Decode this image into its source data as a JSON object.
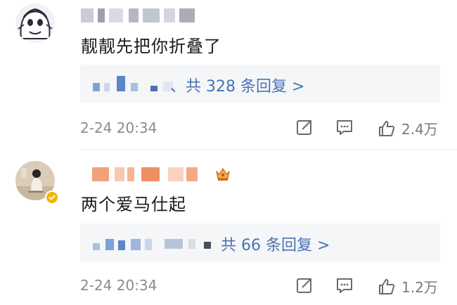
{
  "comments": [
    {
      "content": "靓靓先把你折叠了",
      "replies_link": "、共 328 条回复 >",
      "time": "2-24 20:34",
      "likes": "2.4万",
      "share_icon": "share-icon",
      "comment_icon": "comment-icon",
      "like_icon": "thumbs-up-icon"
    },
    {
      "content": "两个爱马仕起",
      "replies_link": "共 66 条回复 >",
      "time": "2-24 20:34",
      "likes": "1.2万",
      "share_icon": "share-icon",
      "comment_icon": "comment-icon",
      "like_icon": "thumbs-up-icon",
      "verified_color": "#f4b400"
    }
  ],
  "colors": {
    "link": "#4a73b1",
    "muted": "#8c8c8c",
    "reply_bg": "#f5f6f8"
  }
}
